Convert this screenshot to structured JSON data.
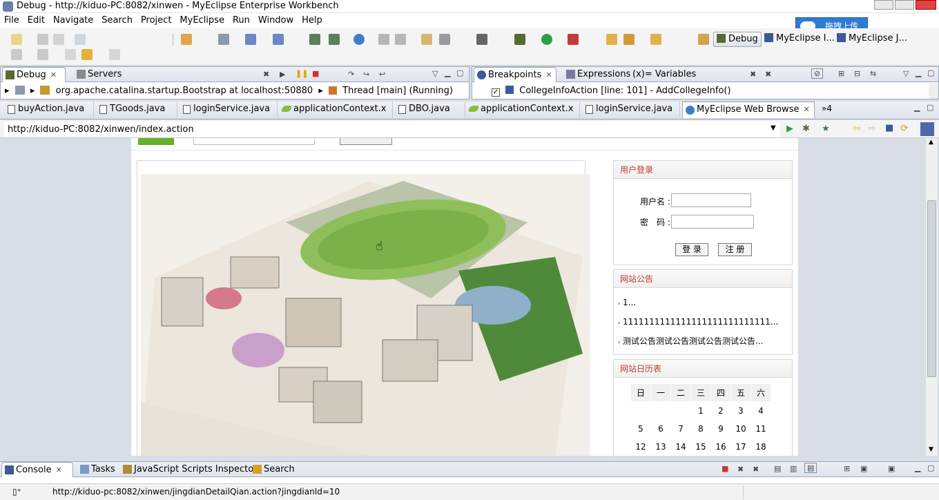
{
  "window": {
    "title": "Debug - http://kiduo-PC:8082/xinwen - MyEclipse Enterprise Workbench",
    "overlay_label": "拖拽上传"
  },
  "menu": [
    "File",
    "Edit",
    "Navigate",
    "Search",
    "Project",
    "MyEclipse",
    "Run",
    "Window",
    "Help"
  ],
  "perspectives": [
    {
      "label": "Debug",
      "active": true
    },
    {
      "label": "MyEclipse I...",
      "active": false
    },
    {
      "label": "MyEclipse J...",
      "active": false
    }
  ],
  "debug_view": {
    "tabs": [
      {
        "label": "Debug",
        "selected": true
      },
      {
        "label": "Servers",
        "selected": false
      }
    ],
    "tree_items": [
      "org.apache.catalina.startup.Bootstrap at localhost:50880",
      "Thread [main] (Running)"
    ]
  },
  "breakpoints_view": {
    "tabs": [
      {
        "label": "Breakpoints",
        "selected": true
      },
      {
        "label": "Expressions",
        "selected": false
      },
      {
        "label": "(x)= Variables",
        "selected": false
      }
    ],
    "items": [
      {
        "label": "CollegeInfoAction [line: 101] - AddCollegeInfo()",
        "checked": true
      }
    ]
  },
  "editor_tabs": [
    {
      "label": "buyAction.java",
      "icon": "java-file-icon"
    },
    {
      "label": "TGoods.java",
      "icon": "java-file-icon"
    },
    {
      "label": "loginService.java",
      "icon": "java-file-icon"
    },
    {
      "label": "applicationContext.x",
      "icon": "spring-leaf-icon"
    },
    {
      "label": "DBO.java",
      "icon": "java-file-icon"
    },
    {
      "label": "applicationContext.x",
      "icon": "spring-leaf-icon"
    },
    {
      "label": "loginService.java",
      "icon": "java-file-icon"
    },
    {
      "label": "MyEclipse Web Browse",
      "icon": "globe-icon",
      "selected": true
    }
  ],
  "editor_overflow": "»4",
  "browser": {
    "url": "http://kiduo-PC:8082/xinwen/index.action"
  },
  "page": {
    "login": {
      "title": "用户登录",
      "username_label": "用户名 :",
      "password_label": "密　码 :",
      "username_value": "",
      "password_value": "",
      "login_button": "登 录",
      "register_button": "注 册"
    },
    "notices": {
      "title": "网站公告",
      "items": [
        "1...",
        "1111111111111111111111111111...",
        "测试公告测试公告测试公告测试公告..."
      ]
    },
    "calendar": {
      "title": "网站日历表",
      "weekdays": [
        "日",
        "一",
        "二",
        "三",
        "四",
        "五",
        "六"
      ],
      "rows": [
        [
          "",
          "",
          "",
          "1",
          "2",
          "3",
          "4"
        ],
        [
          "5",
          "6",
          "7",
          "8",
          "9",
          "10",
          "11"
        ],
        [
          "12",
          "13",
          "14",
          "15",
          "16",
          "17",
          "18"
        ]
      ]
    },
    "campus_image_alt": "campus aerial drawing"
  },
  "bottom_view": {
    "tabs": [
      {
        "label": "Console",
        "selected": true
      },
      {
        "label": "Tasks",
        "selected": false
      },
      {
        "label": "JavaScript Scripts Inspector",
        "selected": false
      },
      {
        "label": "Search",
        "selected": false
      }
    ],
    "status_url": "http://kiduo-pc:8082/xinwen/jingdianDetailQian.action?jingdianId=10"
  },
  "colors": {
    "accent_red": "#c0392b",
    "panel_border": "#9fa9b9"
  }
}
